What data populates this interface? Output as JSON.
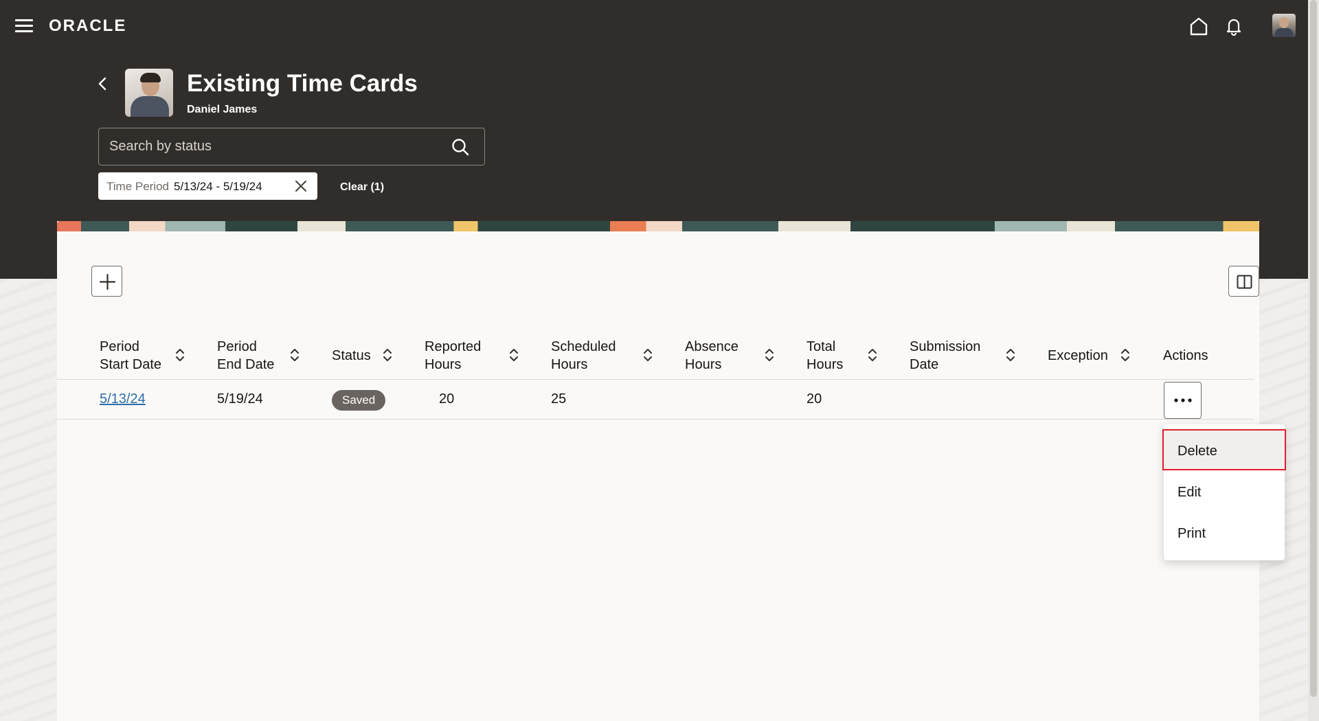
{
  "app": {
    "brand": "ORACLE"
  },
  "header": {
    "title": "Existing Time Cards",
    "subtitle": "Daniel James"
  },
  "search": {
    "placeholder": "Search by status",
    "value": ""
  },
  "filter_chip": {
    "label": "Time Period",
    "value": "5/13/24 - 5/19/24"
  },
  "clear_link": "Clear (1)",
  "table": {
    "columns": [
      {
        "line1": "Period",
        "line2": "Start Date"
      },
      {
        "line1": "Period",
        "line2": "End Date"
      },
      {
        "line1": "Status",
        "line2": ""
      },
      {
        "line1": "Reported",
        "line2": "Hours"
      },
      {
        "line1": "Scheduled",
        "line2": "Hours"
      },
      {
        "line1": "Absence",
        "line2": "Hours"
      },
      {
        "line1": "Total",
        "line2": "Hours"
      },
      {
        "line1": "Submission",
        "line2": "Date"
      },
      {
        "line1": "Exception",
        "line2": ""
      },
      {
        "line1": "Actions",
        "line2": ""
      }
    ],
    "rows": [
      {
        "period_start": "5/13/24",
        "period_end": "5/19/24",
        "status": "Saved",
        "reported_hours": "20",
        "scheduled_hours": "25",
        "absence_hours": "",
        "total_hours": "20",
        "submission_date": "",
        "exception": ""
      }
    ]
  },
  "actions_menu": {
    "items": [
      "Delete",
      "Edit",
      "Print"
    ],
    "selected": "Delete"
  },
  "colors": {
    "header_bg": "#312d2a",
    "link": "#2b6ea8",
    "selected_outline": "#e11d2c",
    "badge_bg": "#6a6460"
  }
}
